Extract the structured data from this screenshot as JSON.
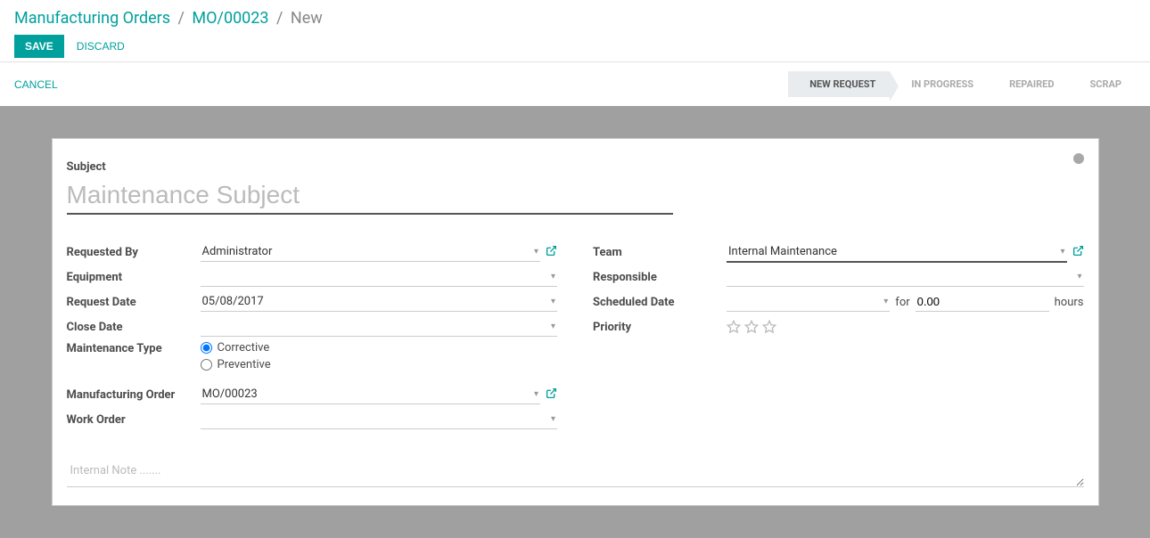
{
  "breadcrumb": {
    "root": "Manufacturing Orders",
    "mid": "MO/00023",
    "current": "New"
  },
  "buttons": {
    "save": "SAVE",
    "discard": "DISCARD",
    "cancel": "CANCEL"
  },
  "status": {
    "steps": [
      "NEW REQUEST",
      "IN PROGRESS",
      "REPAIRED",
      "SCRAP"
    ],
    "active_index": 0
  },
  "form": {
    "subject_label": "Subject",
    "subject_placeholder": "Maintenance Subject",
    "subject_value": "",
    "notes_placeholder": "Internal Note .......",
    "notes_value": ""
  },
  "left": {
    "requested_by": {
      "label": "Requested By",
      "value": "Administrator"
    },
    "equipment": {
      "label": "Equipment",
      "value": ""
    },
    "request_date": {
      "label": "Request Date",
      "value": "05/08/2017"
    },
    "close_date": {
      "label": "Close Date",
      "value": ""
    },
    "maint_type": {
      "label": "Maintenance Type",
      "options": [
        "Corrective",
        "Preventive"
      ],
      "selected": "Corrective"
    },
    "mo": {
      "label": "Manufacturing Order",
      "value": "MO/00023"
    },
    "wo": {
      "label": "Work Order",
      "value": ""
    }
  },
  "right": {
    "team": {
      "label": "Team",
      "value": "Internal Maintenance"
    },
    "responsible": {
      "label": "Responsible",
      "value": ""
    },
    "scheduled": {
      "label": "Scheduled Date",
      "date": "",
      "for_text": "for",
      "hours": "0.00",
      "hours_unit": "hours"
    },
    "priority": {
      "label": "Priority",
      "value": 0
    }
  }
}
